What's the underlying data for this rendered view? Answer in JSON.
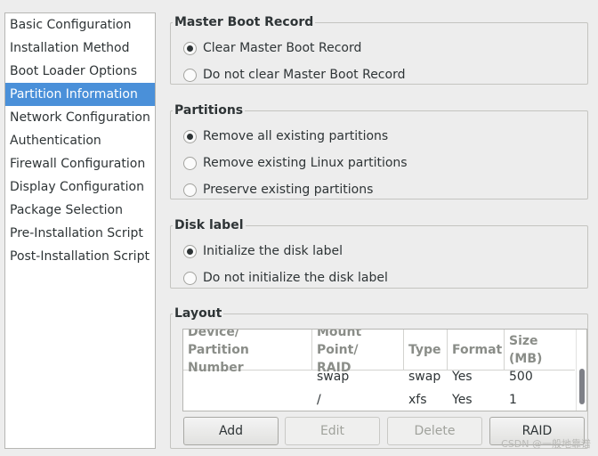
{
  "sidebar": {
    "items": [
      {
        "label": "Basic Configuration"
      },
      {
        "label": "Installation Method"
      },
      {
        "label": "Boot Loader Options"
      },
      {
        "label": "Partition Information",
        "selected": true
      },
      {
        "label": "Network Configuration"
      },
      {
        "label": "Authentication"
      },
      {
        "label": "Firewall Configuration"
      },
      {
        "label": "Display Configuration"
      },
      {
        "label": "Package Selection"
      },
      {
        "label": "Pre-Installation Script"
      },
      {
        "label": "Post-Installation Script"
      }
    ]
  },
  "mbr": {
    "title": "Master Boot Record",
    "options": [
      {
        "label": "Clear Master Boot Record",
        "checked": true
      },
      {
        "label": "Do not clear Master Boot Record",
        "checked": false
      }
    ]
  },
  "partitions": {
    "title": "Partitions",
    "options": [
      {
        "label": "Remove all existing partitions",
        "checked": true
      },
      {
        "label": "Remove existing Linux partitions",
        "checked": false
      },
      {
        "label": "Preserve existing partitions",
        "checked": false
      }
    ]
  },
  "disk_label": {
    "title": "Disk label",
    "options": [
      {
        "label": "Initialize the disk label",
        "checked": true
      },
      {
        "label": "Do not initialize the disk label",
        "checked": false
      }
    ]
  },
  "layout": {
    "title": "Layout",
    "columns": [
      "Device/\nPartition Number",
      "Mount Point/\nRAID",
      "Type",
      "Format",
      "Size (MB)"
    ],
    "rows": [
      [
        "",
        "swap",
        "swap",
        "Yes",
        "500"
      ],
      [
        "",
        "/",
        "xfs",
        "Yes",
        "1"
      ]
    ],
    "buttons": {
      "add": "Add",
      "edit": "Edit",
      "delete": "Delete",
      "raid": "RAID"
    }
  },
  "watermark": "CSDN @一般地靠谱"
}
